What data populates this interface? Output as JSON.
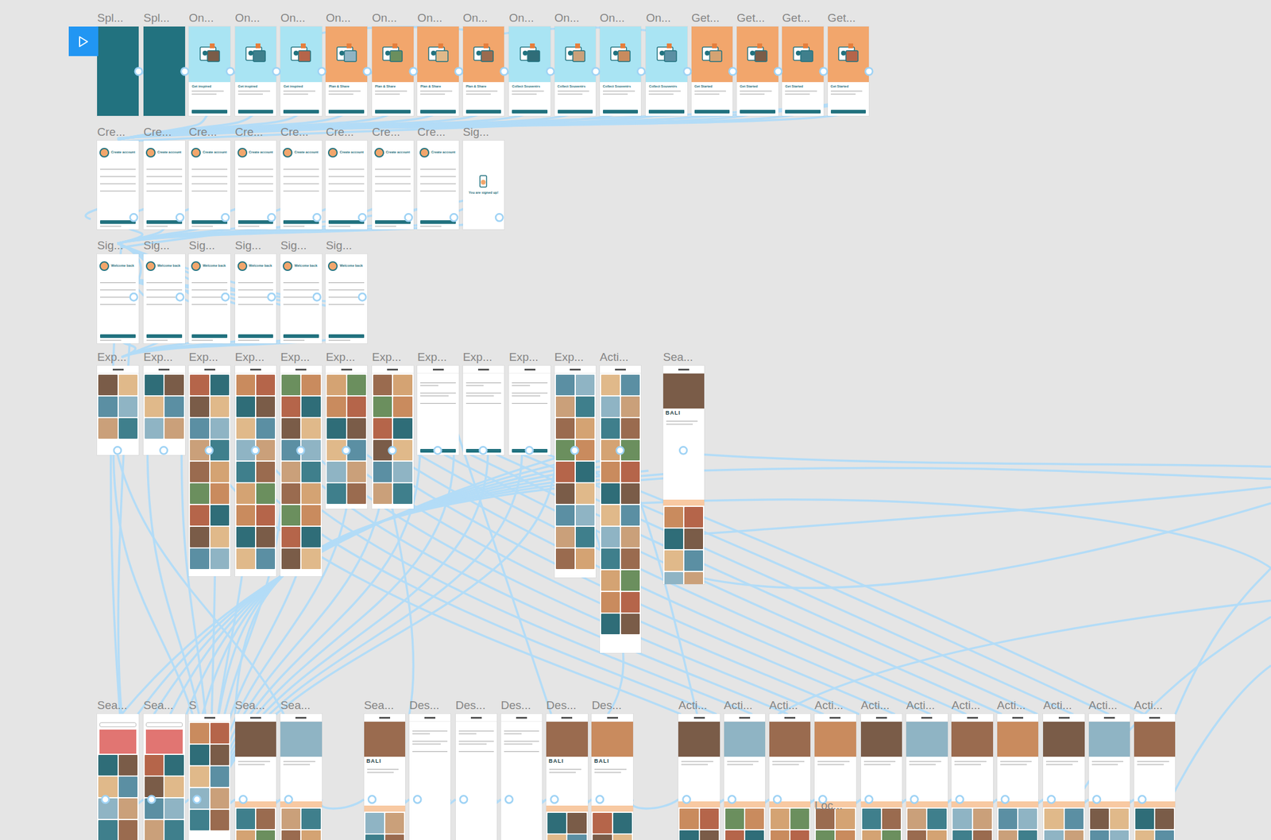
{
  "canvas": {
    "floating_labels": [
      "Loc..."
    ]
  },
  "rows": [
    {
      "frames": [
        {
          "label": "Spl...",
          "kind": "splash"
        },
        {
          "label": "Spl...",
          "kind": "splash"
        },
        {
          "label": "On...",
          "kind": "onboard",
          "title": "Get inspired",
          "color": "#a9e4f3"
        },
        {
          "label": "On...",
          "kind": "onboard",
          "title": "Get inspired",
          "color": "#a9e4f3"
        },
        {
          "label": "On...",
          "kind": "onboard",
          "title": "Get inspired",
          "color": "#a9e4f3"
        },
        {
          "label": "On...",
          "kind": "onboard",
          "title": "Plan & Share",
          "color": "#f2a66c"
        },
        {
          "label": "On...",
          "kind": "onboard",
          "title": "Plan & Share",
          "color": "#f2a66c"
        },
        {
          "label": "On...",
          "kind": "onboard",
          "title": "Plan & Share",
          "color": "#f2a66c"
        },
        {
          "label": "On...",
          "kind": "onboard",
          "title": "Plan & Share",
          "color": "#f2a66c"
        },
        {
          "label": "On...",
          "kind": "onboard",
          "title": "Collect Souvenirs",
          "color": "#a9e4f3"
        },
        {
          "label": "On...",
          "kind": "onboard",
          "title": "Collect Souvenirs",
          "color": "#a9e4f3"
        },
        {
          "label": "On...",
          "kind": "onboard",
          "title": "Collect Souvenirs",
          "color": "#a9e4f3"
        },
        {
          "label": "On...",
          "kind": "onboard",
          "title": "Collect Souvenirs",
          "color": "#a9e4f3"
        },
        {
          "label": "Get...",
          "kind": "onboard",
          "title": "Get Started",
          "color": "#f2a66c"
        },
        {
          "label": "Get...",
          "kind": "onboard",
          "title": "Get Started",
          "color": "#f2a66c"
        },
        {
          "label": "Get...",
          "kind": "onboard",
          "title": "Get Started",
          "color": "#f2a66c"
        },
        {
          "label": "Get...",
          "kind": "onboard",
          "title": "Get Started",
          "color": "#f2a66c"
        }
      ]
    },
    {
      "frames": [
        {
          "label": "Cre...",
          "kind": "form",
          "title": "Create account"
        },
        {
          "label": "Cre...",
          "kind": "form",
          "title": "Create account"
        },
        {
          "label": "Cre...",
          "kind": "form",
          "title": "Create account"
        },
        {
          "label": "Cre...",
          "kind": "form",
          "title": "Create account"
        },
        {
          "label": "Cre...",
          "kind": "form",
          "title": "Create account"
        },
        {
          "label": "Cre...",
          "kind": "form",
          "title": "Create account"
        },
        {
          "label": "Cre...",
          "kind": "form",
          "title": "Create account"
        },
        {
          "label": "Cre...",
          "kind": "form",
          "title": "Create account"
        },
        {
          "label": "Sig...",
          "kind": "success",
          "title": "You are signed up!"
        }
      ]
    },
    {
      "frames": [
        {
          "label": "Sig...",
          "kind": "form",
          "title": "Welcome back"
        },
        {
          "label": "Sig...",
          "kind": "form",
          "title": "Welcome back"
        },
        {
          "label": "Sig...",
          "kind": "form",
          "title": "Welcome back"
        },
        {
          "label": "Sig...",
          "kind": "form",
          "title": "Welcome back"
        },
        {
          "label": "Sig...",
          "kind": "form",
          "title": "Welcome back"
        },
        {
          "label": "Sig...",
          "kind": "form",
          "title": "Welcome back"
        }
      ]
    },
    {
      "frames": [
        {
          "label": "Exp...",
          "kind": "explore"
        },
        {
          "label": "Exp...",
          "kind": "explore"
        },
        {
          "label": "Exp...",
          "kind": "explore"
        },
        {
          "label": "Exp...",
          "kind": "explore"
        },
        {
          "label": "Exp...",
          "kind": "explore"
        },
        {
          "label": "Exp...",
          "kind": "explore"
        },
        {
          "label": "Exp...",
          "kind": "explore"
        },
        {
          "label": "Exp...",
          "kind": "filter"
        },
        {
          "label": "Exp...",
          "kind": "filter"
        },
        {
          "label": "Exp...",
          "kind": "filter"
        },
        {
          "label": "Exp...",
          "kind": "explore"
        },
        {
          "label": "Acti...",
          "kind": "explore"
        },
        {
          "label": "Sea...",
          "kind": "detail",
          "title": "BALI"
        }
      ]
    },
    {
      "frames": [
        {
          "label": "Sea...",
          "kind": "search"
        },
        {
          "label": "Sea...",
          "kind": "search"
        },
        {
          "label": "S",
          "kind": "explore"
        },
        {
          "label": "Sea...",
          "kind": "detail"
        },
        {
          "label": "Sea...",
          "kind": "detail"
        },
        {
          "label": "Sea...",
          "kind": "detail",
          "title": "BALI"
        },
        {
          "label": "Des...",
          "kind": "filter"
        },
        {
          "label": "Des...",
          "kind": "filter"
        },
        {
          "label": "Des...",
          "kind": "filter"
        },
        {
          "label": "Des...",
          "kind": "detail",
          "title": "BALI"
        },
        {
          "label": "Des...",
          "kind": "detail",
          "title": "BALI"
        },
        {
          "label": "Acti...",
          "kind": "detail"
        },
        {
          "label": "Acti...",
          "kind": "detail"
        },
        {
          "label": "Acti...",
          "kind": "detail"
        },
        {
          "label": "Acti...",
          "kind": "detail"
        },
        {
          "label": "Acti...",
          "kind": "detail"
        },
        {
          "label": "Acti...",
          "kind": "detail"
        },
        {
          "label": "Acti...",
          "kind": "detail"
        },
        {
          "label": "Acti...",
          "kind": "detail"
        },
        {
          "label": "Acti...",
          "kind": "detail"
        },
        {
          "label": "Acti...",
          "kind": "detail"
        },
        {
          "label": "Acti...",
          "kind": "detail"
        }
      ]
    }
  ]
}
